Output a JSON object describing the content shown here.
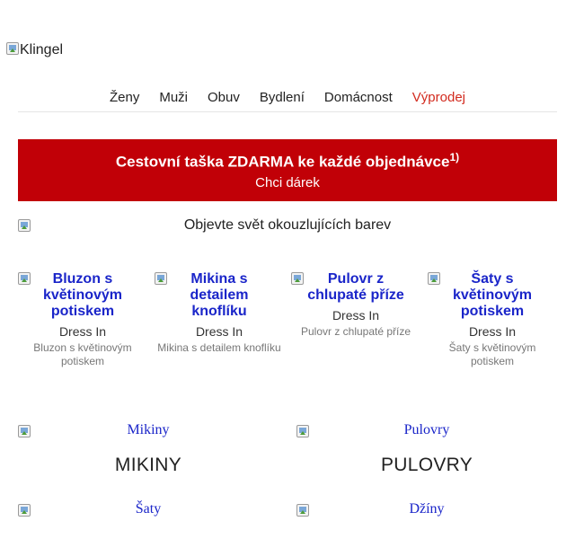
{
  "logo": {
    "alt": "Klingel"
  },
  "nav": [
    {
      "label": "Ženy"
    },
    {
      "label": "Muži"
    },
    {
      "label": "Obuv"
    },
    {
      "label": "Bydlení"
    },
    {
      "label": "Domácnost"
    },
    {
      "label": "Výprodej"
    }
  ],
  "banner": {
    "title": "Cestovní taška ZDARMA ke každé objednávce",
    "footnote": "1)",
    "cta": "Chci dárek",
    "color": "#c10007"
  },
  "hero": {
    "alt": "Objevte svět okouzlujících barev"
  },
  "products": [
    {
      "title": "Bluzon s květinovým potiskem",
      "brand": "Dress In",
      "subtitle": "Bluzon s květinovým potiskem"
    },
    {
      "title": "Mikina s detailem knoflíku",
      "brand": "Dress In",
      "subtitle": "Mikina s detailem knoflíku"
    },
    {
      "title": "Pulovr z chlupaté příze",
      "brand": "Dress In",
      "subtitle": "Pulovr z chlupaté příze"
    },
    {
      "title": "Šaty s květinovým potiskem",
      "brand": "Dress In",
      "subtitle": "Šaty s květinovým potiskem"
    }
  ],
  "categories": [
    {
      "link": "Mikiny",
      "heading": "MIKINY"
    },
    {
      "link": "Pulovry",
      "heading": "PULOVRY"
    },
    {
      "link": "Šaty",
      "heading": ""
    },
    {
      "link": "Džíny",
      "heading": ""
    }
  ],
  "colors": {
    "link": "#1a25c9",
    "sale": "#d22a1e"
  }
}
